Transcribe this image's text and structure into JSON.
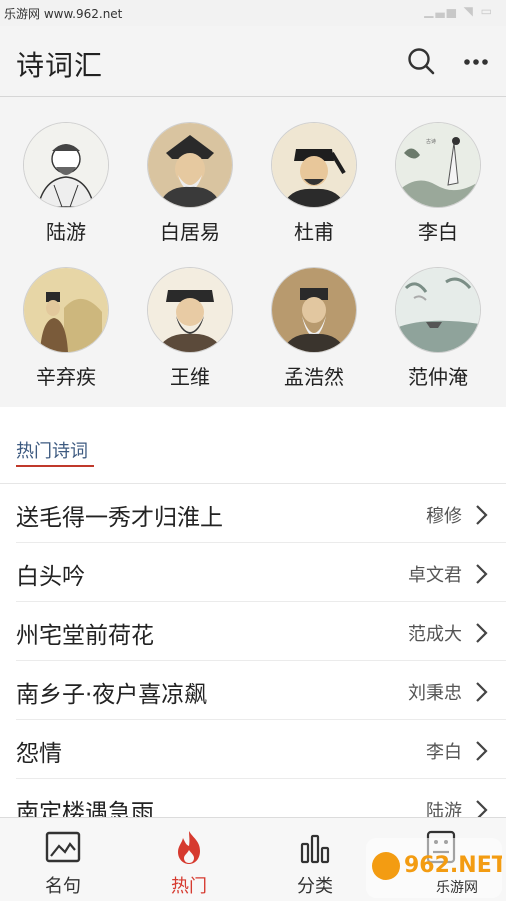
{
  "status_bar": {
    "watermark": "乐游网 www.962.net"
  },
  "header": {
    "title": "诗词汇"
  },
  "poets": [
    {
      "name": "陆游"
    },
    {
      "name": "白居易"
    },
    {
      "name": "杜甫"
    },
    {
      "name": "李白"
    },
    {
      "name": "辛弃疾"
    },
    {
      "name": "王维"
    },
    {
      "name": "孟浩然"
    },
    {
      "name": "范仲淹"
    }
  ],
  "hot": {
    "title": "热门诗词",
    "items": [
      {
        "poem": "送毛得一秀才归淮上",
        "author": "穆修"
      },
      {
        "poem": "白头吟",
        "author": "卓文君"
      },
      {
        "poem": "州宅堂前荷花",
        "author": "范成大"
      },
      {
        "poem": "南乡子·夜户喜凉飙",
        "author": "刘秉忠"
      },
      {
        "poem": "怨情",
        "author": "李白"
      },
      {
        "poem": "南定楼遇急雨",
        "author": "陆游"
      }
    ]
  },
  "bottom_nav": {
    "tabs": [
      {
        "label": "名句",
        "icon": "picture-icon"
      },
      {
        "label": "热门",
        "icon": "flame-icon",
        "active": true
      },
      {
        "label": "分类",
        "icon": "bar-chart-icon"
      },
      {
        "label": "",
        "icon": "list-icon"
      }
    ]
  },
  "badge": {
    "text": "962.NET",
    "sub": "乐游网"
  },
  "colors": {
    "accent": "#d63a2f",
    "section_title": "#3d5a80"
  }
}
